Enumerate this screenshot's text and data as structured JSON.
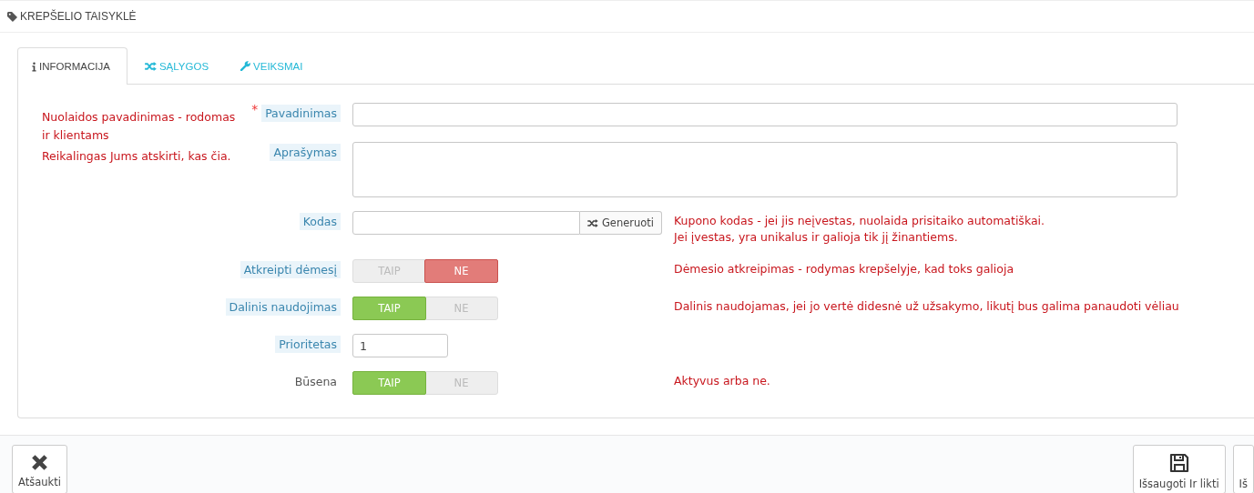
{
  "header": {
    "title": "KREPŠELIO TAISYKLĖ"
  },
  "tabs": [
    {
      "label": "INFORMACIJA",
      "selected": true
    },
    {
      "label": "SĄLYGOS",
      "selected": false
    },
    {
      "label": "VEIKSMAI",
      "selected": false
    }
  ],
  "fields": [
    {
      "kind": "text",
      "label": "Pavadinimas",
      "required_mark": "*",
      "hint": true,
      "left_note": [
        "Nuolaidos pavadinimas - rodomas",
        "ir klientams"
      ]
    },
    {
      "kind": "textarea",
      "label": "Aprašymas",
      "hint": true,
      "left_note": [
        "Reikalingas Jums atskirti, kas čia."
      ]
    },
    {
      "kind": "code",
      "label": "Kodas",
      "hint": true,
      "button": "Generuoti",
      "note": [
        "Kupono kodas - jei jis neįvestas, nuolaida prisitaiko automatiškai.",
        "Jei įvestas, yra unikalus ir galioja tik jį žinantiems."
      ]
    },
    {
      "kind": "switch",
      "label": "Atkreipti dėmesį",
      "hint": true,
      "options": [
        {
          "label": "TAIP",
          "selected": false
        },
        {
          "label": "NE",
          "selected": true
        }
      ],
      "note": [
        "Dėmesio atkreipimas - rodymas krepšelyje, kad toks galioja"
      ]
    },
    {
      "kind": "switch",
      "label": "Dalinis naudojimas",
      "hint": true,
      "options": [
        {
          "label": "TAIP",
          "selected": true
        },
        {
          "label": "NE",
          "selected": false
        }
      ],
      "note": [
        "Dalinis naudojamas, jei jo vertė didesnė už užsakymo, likutį bus galima panaudoti vėliau"
      ]
    },
    {
      "kind": "number",
      "label": "Prioritetas",
      "hint": true,
      "value": "1"
    },
    {
      "kind": "switch",
      "label": "Būsena",
      "hint": false,
      "options": [
        {
          "label": "TAIP",
          "selected": true
        },
        {
          "label": "NE",
          "selected": false
        }
      ],
      "note": [
        "Aktyvus arba ne."
      ]
    }
  ],
  "footer": {
    "buttons": [
      {
        "label": "Atšaukti"
      },
      {
        "label": "Išsaugoti Ir likti"
      },
      {
        "label": "Iš"
      }
    ]
  }
}
